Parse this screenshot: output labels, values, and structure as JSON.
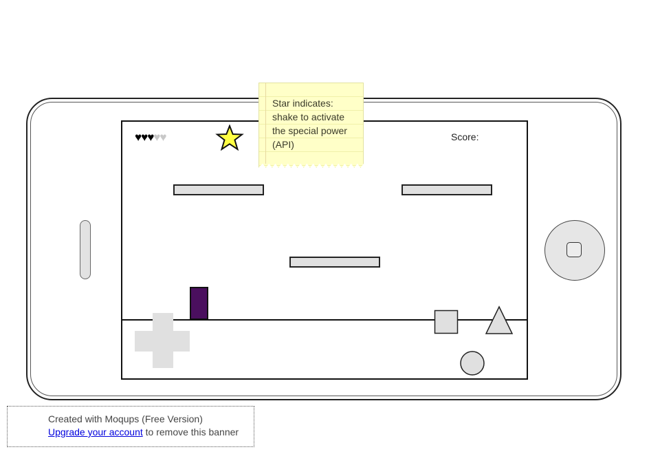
{
  "hud": {
    "hearts_full": "♥♥♥",
    "hearts_empty": "♥♥",
    "lives_remaining": 3,
    "lives_total": 5,
    "score_label": "Score:"
  },
  "sticky_note": {
    "lines": [
      "Star indicates:",
      "shake to activate",
      "the special power",
      "(API)"
    ]
  },
  "banner": {
    "line1": "Created with Moqups (Free Version)",
    "link": "Upgrade your account",
    "line2_rest": "to remove this banner"
  },
  "colors": {
    "player": "#4a0f5e",
    "star": "#ffff44",
    "control_fill": "#e0e0e0",
    "sticky": "#ffffc8"
  },
  "icons": {
    "star": "star-icon",
    "dpad": "dpad-icon",
    "square": "square-button-icon",
    "triangle": "triangle-button-icon",
    "circle": "circle-button-icon",
    "home": "home-button-icon"
  }
}
